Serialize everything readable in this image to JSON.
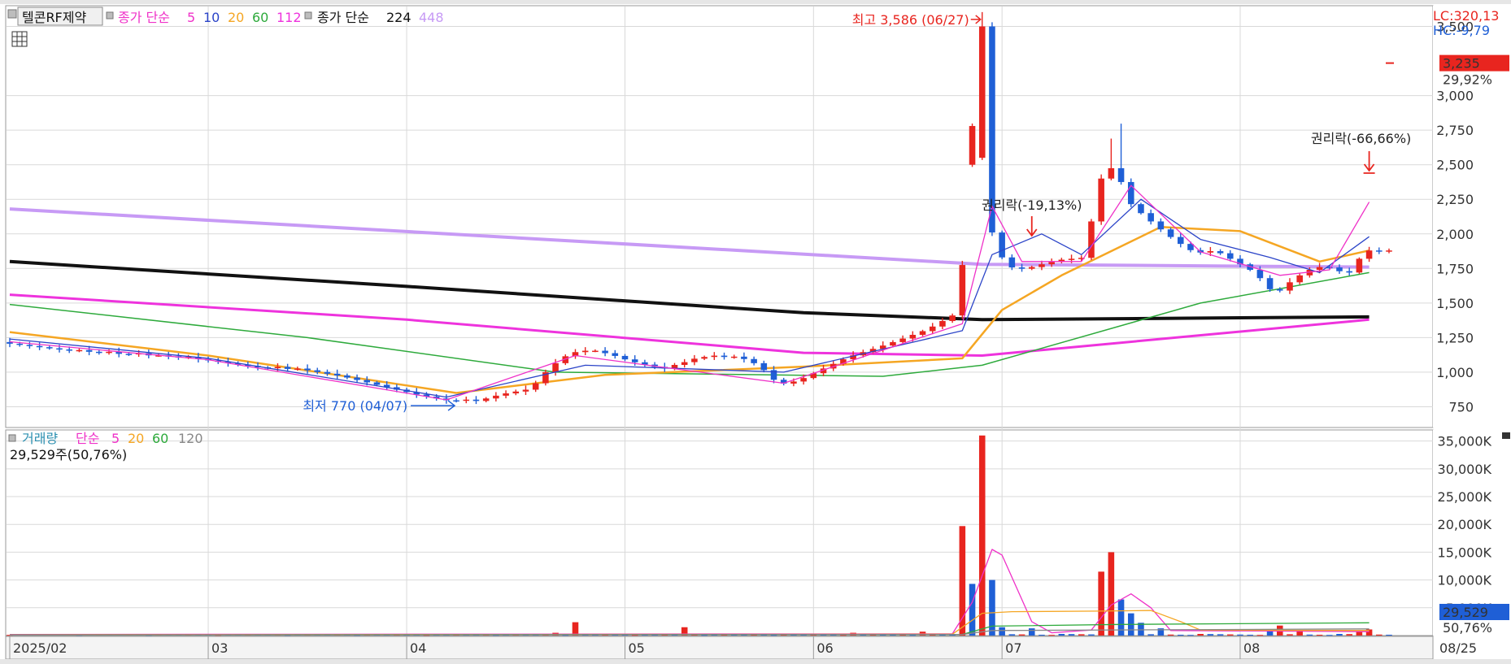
{
  "colors": {
    "up": "#e8251f",
    "down": "#1f5fd6",
    "ma5": "#ef31c8",
    "ma10": "#2b44c8",
    "ma20": "#f5a623",
    "ma60": "#2eaa3c",
    "ma112": "#ee33dd",
    "ma224": "#111111",
    "ma448": "#c79af5",
    "grid": "#d9d9d9",
    "vol120": "#888888"
  },
  "chart_data": [
    {
      "type": "candlestick",
      "title": "텔콘RF제약",
      "legend": {
        "label": "종가 단순",
        "periods": [
          "5",
          "10",
          "20",
          "60",
          "112"
        ],
        "label2": "종가 단순",
        "periods2": [
          "224",
          "448"
        ]
      },
      "ylim": [
        600,
        3650
      ],
      "yticks": [
        "3,500",
        "3,000",
        "2,750",
        "2,500",
        "2,250",
        "2,000",
        "1,750",
        "1,500",
        "1,250",
        "1,000",
        "750"
      ],
      "yticks_values": [
        3500,
        3000,
        2750,
        2500,
        2250,
        2000,
        1750,
        1500,
        1250,
        1000,
        750
      ],
      "x_labels": [
        "2025/02",
        "03",
        "04",
        "05",
        "06",
        "07",
        "08",
        "08/25"
      ],
      "x_label_index": [
        0,
        20,
        40,
        62,
        81,
        100,
        124,
        142
      ],
      "n_bars": 140,
      "lc": "LC:320,13",
      "hc": "HC:-9,79",
      "current_price": "3,235",
      "current_price_value": 3235,
      "change_pct": "29,92%",
      "annotations": {
        "high": "최고 3,586 (06/27)",
        "high_value": 3586,
        "high_index": 98,
        "low": "최저 770 (04/07)",
        "low_value": 770,
        "low_index": 45,
        "ex_rights_1": "권리락(-19,13%)",
        "ex_rights_1_index": 103,
        "ex_rights_2": "권리락(-66,66%)",
        "ex_rights_2_index": 137
      },
      "price_anchors": [
        [
          0,
          1210
        ],
        [
          6,
          1160
        ],
        [
          12,
          1130
        ],
        [
          18,
          1110
        ],
        [
          22,
          1070
        ],
        [
          26,
          1030
        ],
        [
          30,
          1020
        ],
        [
          34,
          970
        ],
        [
          38,
          900
        ],
        [
          42,
          830
        ],
        [
          45,
          790
        ],
        [
          48,
          800
        ],
        [
          50,
          840
        ],
        [
          53,
          880
        ],
        [
          55,
          1040
        ],
        [
          57,
          1140
        ],
        [
          59,
          1160
        ],
        [
          61,
          1130
        ],
        [
          63,
          1080
        ],
        [
          66,
          1030
        ],
        [
          68,
          1060
        ],
        [
          70,
          1110
        ],
        [
          74,
          1110
        ],
        [
          76,
          1050
        ],
        [
          78,
          910
        ],
        [
          80,
          940
        ],
        [
          82,
          1010
        ],
        [
          85,
          1110
        ],
        [
          88,
          1180
        ],
        [
          90,
          1230
        ],
        [
          93,
          1310
        ],
        [
          96,
          1430
        ],
        [
          97,
          2120
        ],
        [
          98,
          3586
        ],
        [
          99,
          2120
        ],
        [
          100,
          1900
        ],
        [
          101,
          1760
        ],
        [
          103,
          1750
        ],
        [
          106,
          1810
        ],
        [
          109,
          1830
        ],
        [
          110,
          2350
        ],
        [
          111,
          2450
        ],
        [
          112,
          2500
        ],
        [
          113,
          2250
        ],
        [
          114,
          2180
        ],
        [
          116,
          2060
        ],
        [
          118,
          1950
        ],
        [
          120,
          1860
        ],
        [
          122,
          1880
        ],
        [
          124,
          1800
        ],
        [
          126,
          1720
        ],
        [
          128,
          1560
        ],
        [
          130,
          1680
        ],
        [
          132,
          1760
        ],
        [
          134,
          1760
        ],
        [
          135,
          1700
        ],
        [
          136,
          1760
        ],
        [
          137,
          1880
        ]
      ],
      "ma_series": [
        {
          "name": "448",
          "points": [
            [
              0,
              2180
            ],
            [
              98,
              1780
            ],
            [
              137,
              1760
            ]
          ]
        },
        {
          "name": "224",
          "points": [
            [
              0,
              1800
            ],
            [
              40,
              1620
            ],
            [
              80,
              1430
            ],
            [
              98,
              1380
            ],
            [
              137,
              1400
            ]
          ]
        },
        {
          "name": "112",
          "points": [
            [
              0,
              1560
            ],
            [
              40,
              1380
            ],
            [
              80,
              1140
            ],
            [
              98,
              1120
            ],
            [
              137,
              1380
            ]
          ]
        },
        {
          "name": "60",
          "points": [
            [
              0,
              1490
            ],
            [
              30,
              1250
            ],
            [
              55,
              1000
            ],
            [
              88,
              970
            ],
            [
              98,
              1050
            ],
            [
              120,
              1500
            ],
            [
              137,
              1720
            ]
          ]
        },
        {
          "name": "20",
          "points": [
            [
              0,
              1290
            ],
            [
              20,
              1120
            ],
            [
              45,
              850
            ],
            [
              60,
              980
            ],
            [
              80,
              1040
            ],
            [
              96,
              1100
            ],
            [
              100,
              1450
            ],
            [
              106,
              1700
            ],
            [
              116,
              2050
            ],
            [
              124,
              2020
            ],
            [
              132,
              1800
            ],
            [
              137,
              1880
            ]
          ]
        },
        {
          "name": "10",
          "points": [
            [
              0,
              1240
            ],
            [
              20,
              1100
            ],
            [
              44,
              820
            ],
            [
              58,
              1050
            ],
            [
              78,
              1000
            ],
            [
              96,
              1300
            ],
            [
              99,
              1850
            ],
            [
              104,
              2000
            ],
            [
              108,
              1850
            ],
            [
              114,
              2250
            ],
            [
              120,
              1960
            ],
            [
              127,
              1830
            ],
            [
              132,
              1720
            ],
            [
              137,
              1980
            ]
          ]
        },
        {
          "name": "5",
          "points": [
            [
              0,
              1220
            ],
            [
              20,
              1090
            ],
            [
              44,
              800
            ],
            [
              57,
              1120
            ],
            [
              78,
              920
            ],
            [
              96,
              1350
            ],
            [
              99,
              2200
            ],
            [
              102,
              1800
            ],
            [
              108,
              1800
            ],
            [
              113,
              2350
            ],
            [
              120,
              1870
            ],
            [
              128,
              1700
            ],
            [
              133,
              1740
            ],
            [
              137,
              2230
            ]
          ]
        }
      ]
    },
    {
      "type": "bar",
      "title": "거래량",
      "legend": {
        "label": "단순",
        "periods": [
          "5",
          "20",
          "60",
          "120"
        ]
      },
      "info": "29,529주(50,76%)",
      "ylim": [
        0,
        37000
      ],
      "yticks": [
        "35,000K",
        "30,000K",
        "25,000K",
        "20,000K",
        "15,000K",
        "10,000K",
        "5,000K"
      ],
      "yticks_values": [
        35000,
        30000,
        25000,
        20000,
        15000,
        10000,
        5000
      ],
      "current_volume": "29,529",
      "current_volume_pct": "50,76%",
      "spikes": [
        [
          55,
          500,
          "up"
        ],
        [
          57,
          2400,
          "up"
        ],
        [
          68,
          1500,
          "up"
        ],
        [
          85,
          500,
          "up"
        ],
        [
          92,
          700,
          "up"
        ],
        [
          96,
          19700,
          "up"
        ],
        [
          97,
          9300,
          "down"
        ],
        [
          98,
          36000,
          "up"
        ],
        [
          99,
          10000,
          "down"
        ],
        [
          100,
          1500,
          "down"
        ],
        [
          103,
          1300,
          "down"
        ],
        [
          110,
          11500,
          "up"
        ],
        [
          111,
          15000,
          "up"
        ],
        [
          112,
          6500,
          "down"
        ],
        [
          113,
          4000,
          "down"
        ],
        [
          114,
          2300,
          "down"
        ],
        [
          116,
          1300,
          "down"
        ],
        [
          127,
          900,
          "down"
        ],
        [
          128,
          1800,
          "up"
        ],
        [
          130,
          900,
          "up"
        ],
        [
          136,
          700,
          "up"
        ],
        [
          137,
          1100,
          "up"
        ]
      ],
      "base_volume": 200,
      "ma_series": [
        {
          "name": "5",
          "points": [
            [
              0,
              200
            ],
            [
              95,
              300
            ],
            [
              97,
              6000
            ],
            [
              99,
              15500
            ],
            [
              100,
              14500
            ],
            [
              103,
              2500
            ],
            [
              105,
              500
            ],
            [
              109,
              1000
            ],
            [
              111,
              5500
            ],
            [
              113,
              7500
            ],
            [
              115,
              5000
            ],
            [
              117,
              900
            ],
            [
              137,
              700
            ]
          ]
        },
        {
          "name": "20",
          "points": [
            [
              0,
              150
            ],
            [
              95,
              250
            ],
            [
              98,
              4000
            ],
            [
              101,
              4300
            ],
            [
              110,
              4400
            ],
            [
              115,
              4500
            ],
            [
              118,
              2500
            ],
            [
              120,
              1000
            ],
            [
              137,
              900
            ]
          ]
        },
        {
          "name": "60",
          "points": [
            [
              0,
              100
            ],
            [
              96,
              200
            ],
            [
              99,
              1700
            ],
            [
              112,
              2000
            ],
            [
              137,
              2300
            ]
          ]
        },
        {
          "name": "120",
          "points": [
            [
              0,
              100
            ],
            [
              96,
              200
            ],
            [
              99,
              900
            ],
            [
              137,
              1200
            ]
          ]
        }
      ]
    }
  ]
}
